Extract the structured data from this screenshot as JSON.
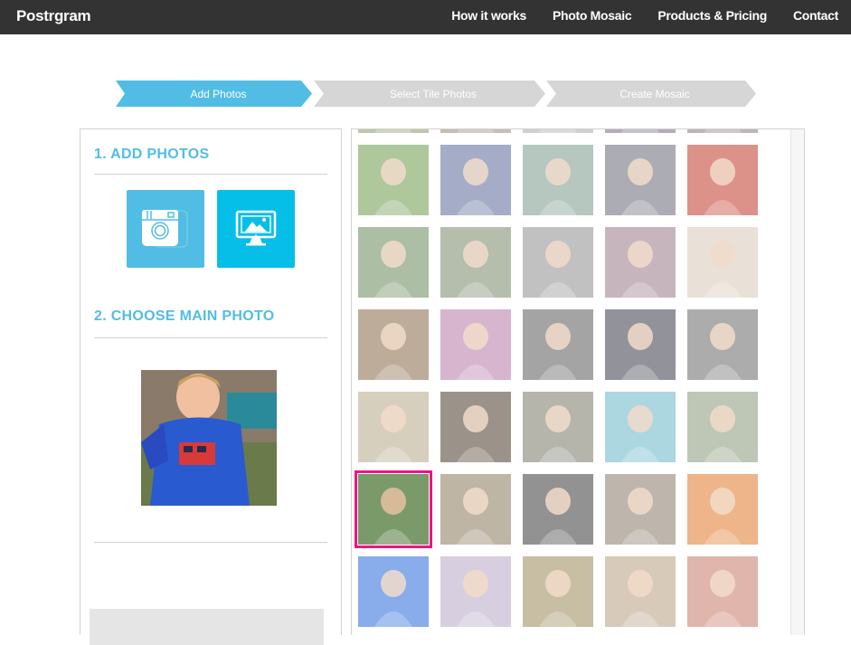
{
  "header": {
    "brand": "Postrgram",
    "nav": [
      "How it works",
      "Photo Mosaic",
      "Products & Pricing",
      "Contact"
    ]
  },
  "steps": [
    {
      "label": "Add Photos",
      "active": true
    },
    {
      "label": "Select Tile Photos",
      "active": false
    },
    {
      "label": "Create Mosaic",
      "active": false
    }
  ],
  "left_panel": {
    "add_photos_title": "1. ADD PHOTOS",
    "sources": [
      {
        "name": "instagram",
        "icon": "instagram-camera-icon"
      },
      {
        "name": "computer",
        "icon": "desktop-image-icon"
      }
    ],
    "choose_main_title": "2. CHOOSE MAIN PHOTO",
    "main_photo": "toddler in blue fire-truck shirt"
  },
  "tiles": {
    "selected_index": 25,
    "colors": [
      [
        "#8a9a6a",
        "#9a8a7a",
        "#aaaaaa",
        "#7a6a8a",
        "#8a7a7a"
      ],
      [
        "#6c9a4a",
        "#5a6a9a",
        "#7a9a8a",
        "#6a6a7a",
        "#c23a2a"
      ],
      [
        "#6a8a5a",
        "#7a8a6a",
        "#909090",
        "#9a7a8a",
        "#d8c8b8"
      ],
      [
        "#8a6a4a",
        "#b87aa8",
        "#5a5a5a",
        "#3a3a4a",
        "#6a6a6a"
      ],
      [
        "#b8a888",
        "#4a3a2a",
        "#7a7a6a",
        "#6ab8c8",
        "#8a9a7a"
      ],
      [
        "#7a9a6a",
        "#8a7a5a",
        "#3a3a3a",
        "#8a7a6a",
        "#e07a2a"
      ],
      [
        "#2a6adc",
        "#b8a8c8",
        "#9a8a5a",
        "#b8a080",
        "#c87a6a"
      ]
    ]
  },
  "colors": {
    "accent": "#52bde4",
    "accent_bright": "#05bfe8",
    "header_bg": "#333333",
    "step_inactive": "#d6d6d6",
    "selected_outline": "#ee1486"
  }
}
